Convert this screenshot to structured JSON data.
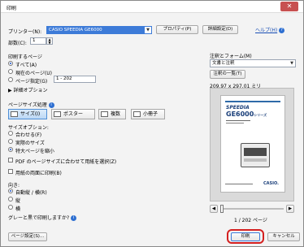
{
  "window": {
    "title": "印刷",
    "close_label": "✕"
  },
  "help": {
    "label": "ヘルプ(H)"
  },
  "printer": {
    "label": "プリンター(N):",
    "value": "CASIO SPEEDIA GE6000",
    "properties_label": "プロパティ(P)",
    "details_label": "詳細設定(D)"
  },
  "copies": {
    "label": "部数(C):",
    "value": "1"
  },
  "pages": {
    "heading": "印刷するページ",
    "all_label": "すべて(A)",
    "current_label": "現在のページ(U)",
    "range_label": "ページ指定(G)",
    "range_value": "1 - 202",
    "more_options_label": "詳細オプション"
  },
  "sizing": {
    "heading": "ページサイズ処理",
    "tabs": [
      "サイズ(I)",
      "ポスター",
      "複数",
      "小冊子"
    ],
    "options_heading": "サイズオプション:",
    "fit_label": "合わせる(F)",
    "actual_label": "実際のサイズ",
    "shrink_label": "特大ページを縮小",
    "pdf_paper_label": "PDF のページサイズに合わせて用紙を選択(Z)",
    "duplex_label": "用紙の両面に印刷(B)"
  },
  "orientation": {
    "heading": "向き:",
    "auto_label": "自動縦 / 横(R)",
    "portrait_label": "縦",
    "landscape_label": "横"
  },
  "grayscale": {
    "label": "グレーと黒で印刷しますか?"
  },
  "comments": {
    "heading": "注釈とフォーム(M)",
    "value": "文書と注釈",
    "summary_button": "注釈の一覧(T)"
  },
  "preview": {
    "page_size": "209.97 x 297.01 ミリ",
    "page_counter": "1 / 202 ページ",
    "doc_title": "SPEEDIA",
    "doc_model": "GE6000",
    "doc_model_suffix": "シリーズ",
    "doc_brand": "CASIO."
  },
  "footer": {
    "page_setup_label": "ページ設定(S)...",
    "print_label": "印刷",
    "cancel_label": "キャンセル"
  },
  "colors": {
    "accent": "#1e56c9",
    "highlight_ring": "#d42020",
    "close": "#c75050"
  }
}
